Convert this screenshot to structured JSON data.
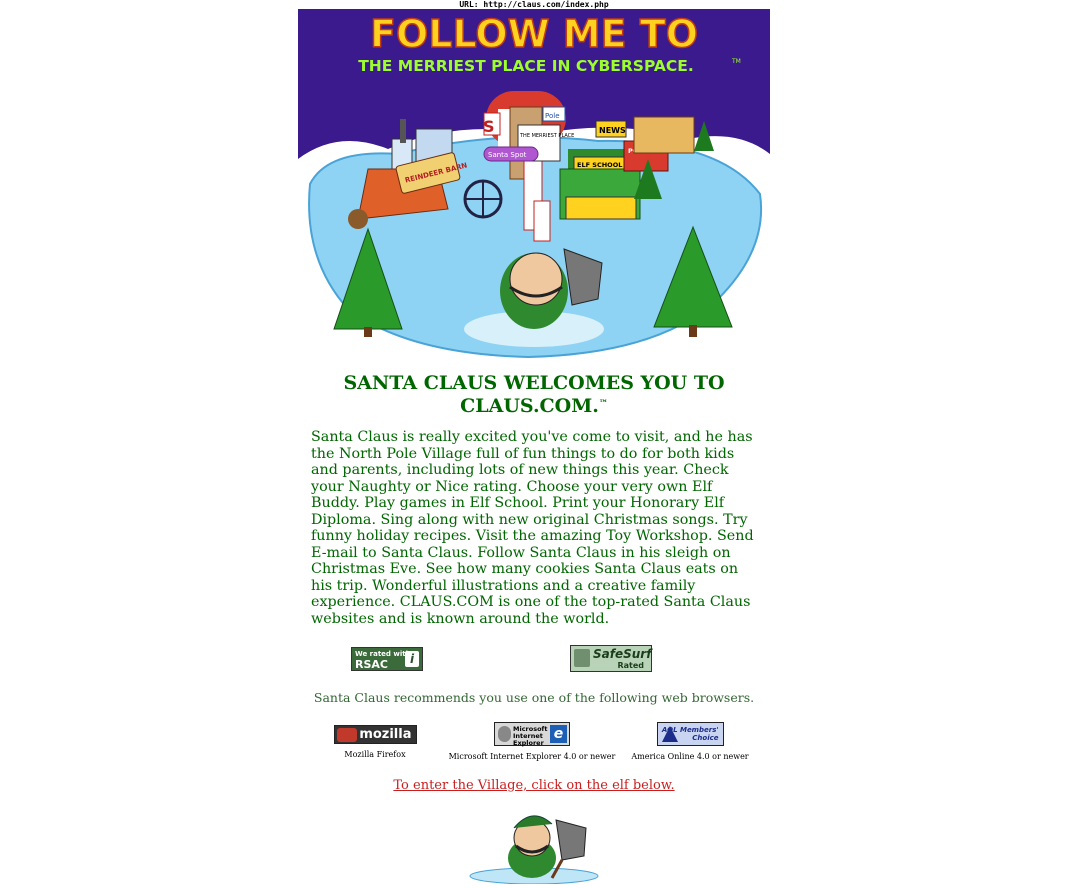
{
  "url_bar": {
    "text": "URL: http://claus.com/index.php"
  },
  "hero": {
    "headline": "FOLLOW ME TO",
    "tagline": "THE MERRIEST PLACE IN CYBERSPACE.",
    "tagline_mark": "TM",
    "signs": {
      "pole": "Pole",
      "the_merriest_place": "THE MERRIEST PLACE",
      "santa_spot": "Santa Spot",
      "news": "NEWS",
      "polar_post": "POLAR POST",
      "elf_school": "ELF SCHOOL",
      "reindeer_barn": "REINDEER BARN"
    }
  },
  "welcome": {
    "title": "SANTA CLAUS WELCOMES YOU TO CLAUS.COM.",
    "title_mark": "™",
    "body": "Santa Claus is really excited you've come to visit, and he has the North Pole Village full of fun things to do for both kids and parents, including lots of new things this year. Check your Naughty or Nice rating. Choose your very own Elf Buddy. Play games in Elf School. Print your Honorary Elf Diploma. Sing along with new original Christmas songs. Try funny holiday recipes. Visit the amazing Toy Workshop. Send E-mail to Santa Claus. Follow Santa Claus in his sleigh on Christmas Eve. See how many cookies Santa Claus eats on his trip. Wonderful illustrations and a creative family experience. CLAUS.COM is one of the top-rated Santa Claus websites and is known around the world."
  },
  "ratings": {
    "rsac": {
      "line1": "We rated with",
      "line2": "RSAC",
      "icon": "i"
    },
    "safesurf": {
      "line1": "SafeSurf",
      "line2": "Rated"
    }
  },
  "browsers": {
    "intro": "Santa Claus recommends you use one of the following web browsers.",
    "items": [
      {
        "logo_text": "mozilla",
        "caption": "Mozilla Firefox"
      },
      {
        "logo_text": "Microsoft Internet Explorer",
        "caption": "Microsoft Internet Explorer 4.0 or newer"
      },
      {
        "logo_text": "AOL Members' Choice",
        "caption": "America Online 4.0 or newer"
      }
    ]
  },
  "enter": {
    "text": "To enter the Village, click on the elf below."
  },
  "colors": {
    "sky": "#3a1a8c",
    "ice": "#8fd3f4",
    "green_text": "#006600",
    "link_red": "#c81e1e"
  }
}
